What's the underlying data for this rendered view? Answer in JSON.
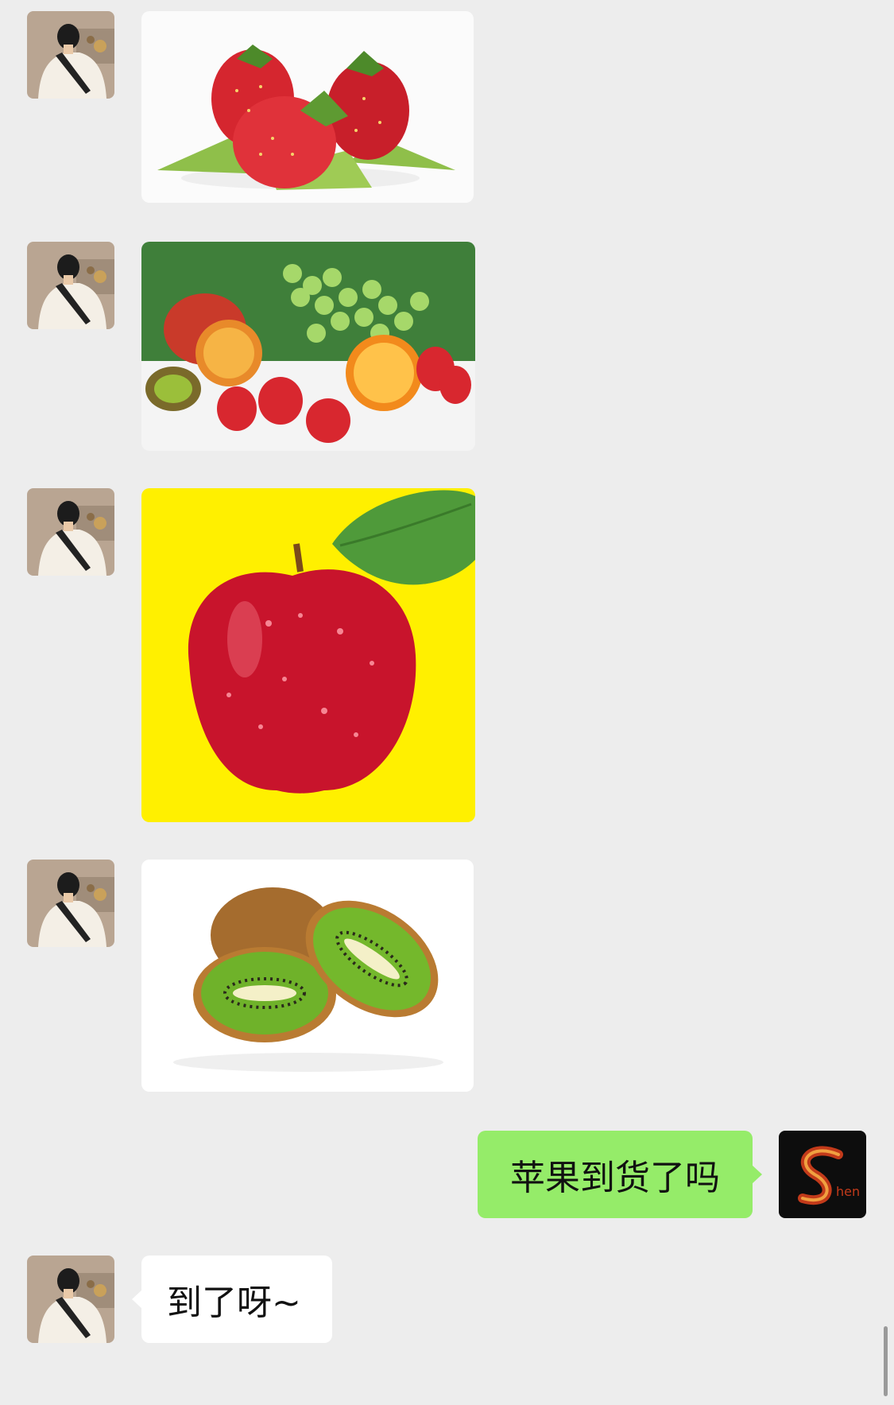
{
  "chat": {
    "me_message": "苹果到货了吗",
    "reply_message": "到了呀~",
    "images": [
      {
        "subject": "strawberries"
      },
      {
        "subject": "mixed-fruit"
      },
      {
        "subject": "red-apple"
      },
      {
        "subject": "kiwi"
      }
    ]
  },
  "avatars": {
    "contact_icon": "man-with-backpack",
    "me_logo_text": "hen"
  },
  "colors": {
    "background": "#ededed",
    "my_bubble": "#95ec69",
    "their_bubble": "#ffffff",
    "apple_backdrop": "#fff000"
  }
}
